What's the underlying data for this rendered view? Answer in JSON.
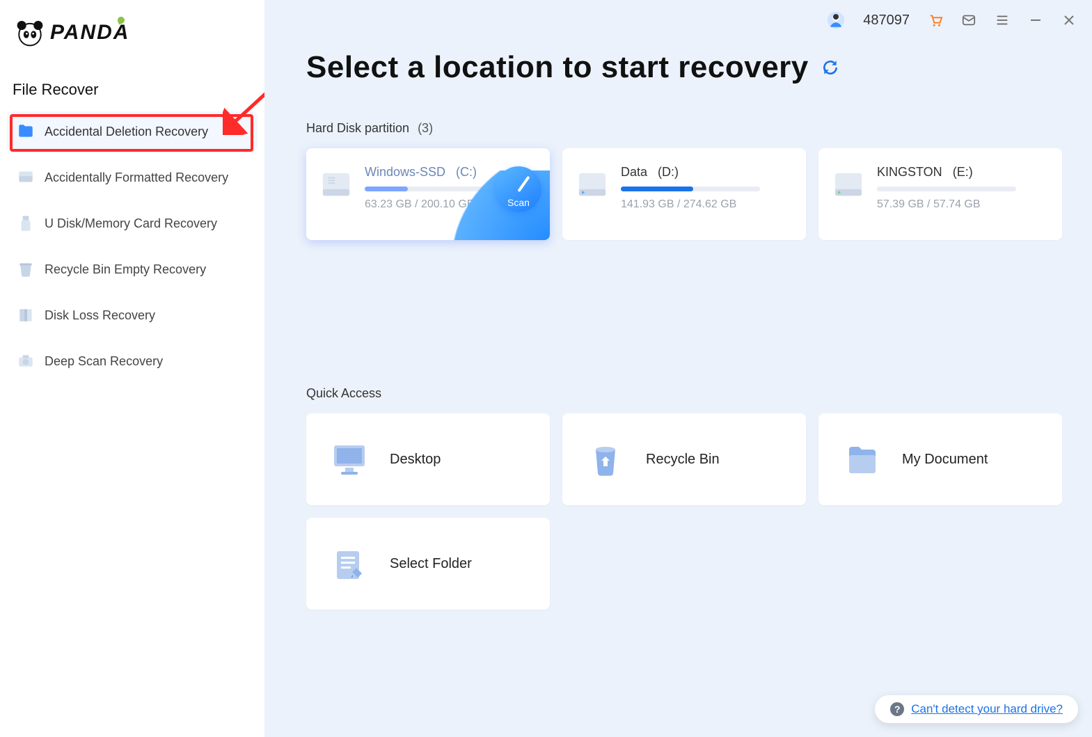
{
  "app_name": "PANDA",
  "sidebar": {
    "title": "File Recover",
    "items": [
      {
        "label": "Accidental Deletion Recovery",
        "icon": "folder-icon",
        "active": true
      },
      {
        "label": "Accidentally Formatted Recovery",
        "icon": "drive-icon",
        "active": false
      },
      {
        "label": "U Disk/Memory Card Recovery",
        "icon": "usb-icon",
        "active": false
      },
      {
        "label": "Recycle Bin Empty Recovery",
        "icon": "trash-icon",
        "active": false
      },
      {
        "label": "Disk Loss Recovery",
        "icon": "book-icon",
        "active": false
      },
      {
        "label": "Deep Scan Recovery",
        "icon": "camera-icon",
        "active": false
      }
    ]
  },
  "topbar": {
    "user_id": "487097"
  },
  "main": {
    "title": "Select a location to start recovery",
    "partitions": {
      "heading": "Hard Disk partition",
      "count": "(3)",
      "items": [
        {
          "name": "Windows-SSD",
          "letter": "(C:)",
          "used_gb": 63.23,
          "total_gb": 200.1,
          "size_text": "63.23 GB / 200.10 GB",
          "fill_pct": 31,
          "color": "#7ea6ff",
          "selected": true,
          "scan_label": "Scan"
        },
        {
          "name": "Data",
          "letter": "(D:)",
          "used_gb": 141.93,
          "total_gb": 274.62,
          "size_text": "141.93 GB / 274.62 GB",
          "fill_pct": 52,
          "color": "#1a73e8",
          "selected": false
        },
        {
          "name": "KINGSTON",
          "letter": "(E:)",
          "used_gb": 57.39,
          "total_gb": 57.74,
          "size_text": "57.39 GB / 57.74 GB",
          "fill_pct": 0,
          "color": "#1a73e8",
          "selected": false
        }
      ]
    },
    "quick_access": {
      "heading": "Quick Access",
      "items": [
        {
          "label": "Desktop",
          "icon": "desktop-icon"
        },
        {
          "label": "Recycle Bin",
          "icon": "recycle-icon"
        },
        {
          "label": "My Document",
          "icon": "document-icon"
        },
        {
          "label": "Select Folder",
          "icon": "folder-edit-icon"
        }
      ]
    }
  },
  "help_link": "Can't detect your hard drive?"
}
